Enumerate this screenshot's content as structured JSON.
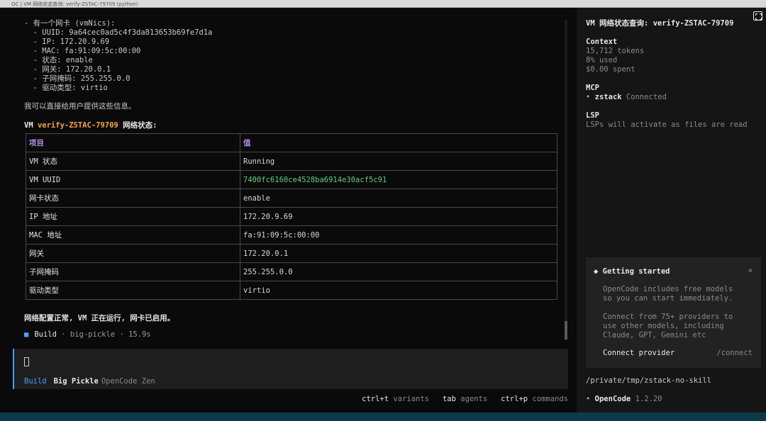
{
  "window": {
    "title": "OC | VM 网络状态查询: verify-ZSTAC-79709 (python)"
  },
  "transcript": {
    "nic_lines": [
      "- 有一个网卡 (vmNics):",
      "  - UUID: 9a64cec0ad5c4f3da813653b69fe7d1a",
      "  - IP: 172.20.9.69",
      "  - MAC: fa:91:09:5c:00:00",
      "  - 状态: enable",
      "  - 网关: 172.20.0.1",
      "  - 子网掩码: 255.255.0.0",
      "  - 驱动类型: virtio"
    ],
    "intro": "我可以直接给用户提供这些信息。",
    "heading_prefix": "VM ",
    "heading_vm": "verify-ZSTAC-79709",
    "heading_suffix": " 网络状态:",
    "table": {
      "headers": [
        "项目",
        "值"
      ],
      "rows": [
        [
          "VM 状态",
          "Running"
        ],
        [
          "VM UUID",
          "7400fc6160ce4528ba6914e30acf5c91"
        ],
        [
          "网卡状态",
          "enable"
        ],
        [
          "IP 地址",
          "172.20.9.69"
        ],
        [
          "MAC 地址",
          "fa:91:09:5c:00:00"
        ],
        [
          "网关",
          "172.20.0.1"
        ],
        [
          "子网掩码",
          "255.255.0.0"
        ],
        [
          "驱动类型",
          "virtio"
        ]
      ]
    },
    "summary": "网络配置正常, VM 正在运行, 网卡已启用。",
    "build": {
      "agent": "Build",
      "model": "big-pickle",
      "duration": "15.9s"
    }
  },
  "input": {
    "mode": "Build",
    "model": "Big Pickle",
    "provider": "OpenCode Zen"
  },
  "hints": [
    {
      "key": "ctrl+t",
      "label": "variants"
    },
    {
      "key": "tab",
      "label": "agents"
    },
    {
      "key": "ctrl+p",
      "label": "commands"
    }
  ],
  "sidebar": {
    "title": "VM 网络状态查询: verify-ZSTAC-79709",
    "context": {
      "heading": "Context",
      "tokens": "15,712 tokens",
      "used": "8% used",
      "spent": "$0.00 spent"
    },
    "mcp": {
      "heading": "MCP",
      "name": "zstack",
      "status": "Connected"
    },
    "lsp": {
      "heading": "LSP",
      "note": "LSPs will activate as files are read"
    },
    "getting_started": {
      "title": "Getting started",
      "close": "×",
      "p1": [
        "OpenCode includes free models",
        "so you can start immediately."
      ],
      "p2": [
        "Connect from 75+ providers to",
        "use other models, including",
        "Claude, GPT, Gemini etc"
      ],
      "connect_label": "Connect provider",
      "connect_cmd": "/connect"
    },
    "path": "/private/tmp/zstack-no-skill",
    "app": {
      "name": "OpenCode",
      "version": "1.2.20"
    }
  },
  "colors": {
    "accent": "#4aa0ff",
    "vm_name": "#f5a742",
    "table_header": "#b58ee8",
    "uuid": "#5fd07a",
    "connected": "#5fd07a"
  }
}
